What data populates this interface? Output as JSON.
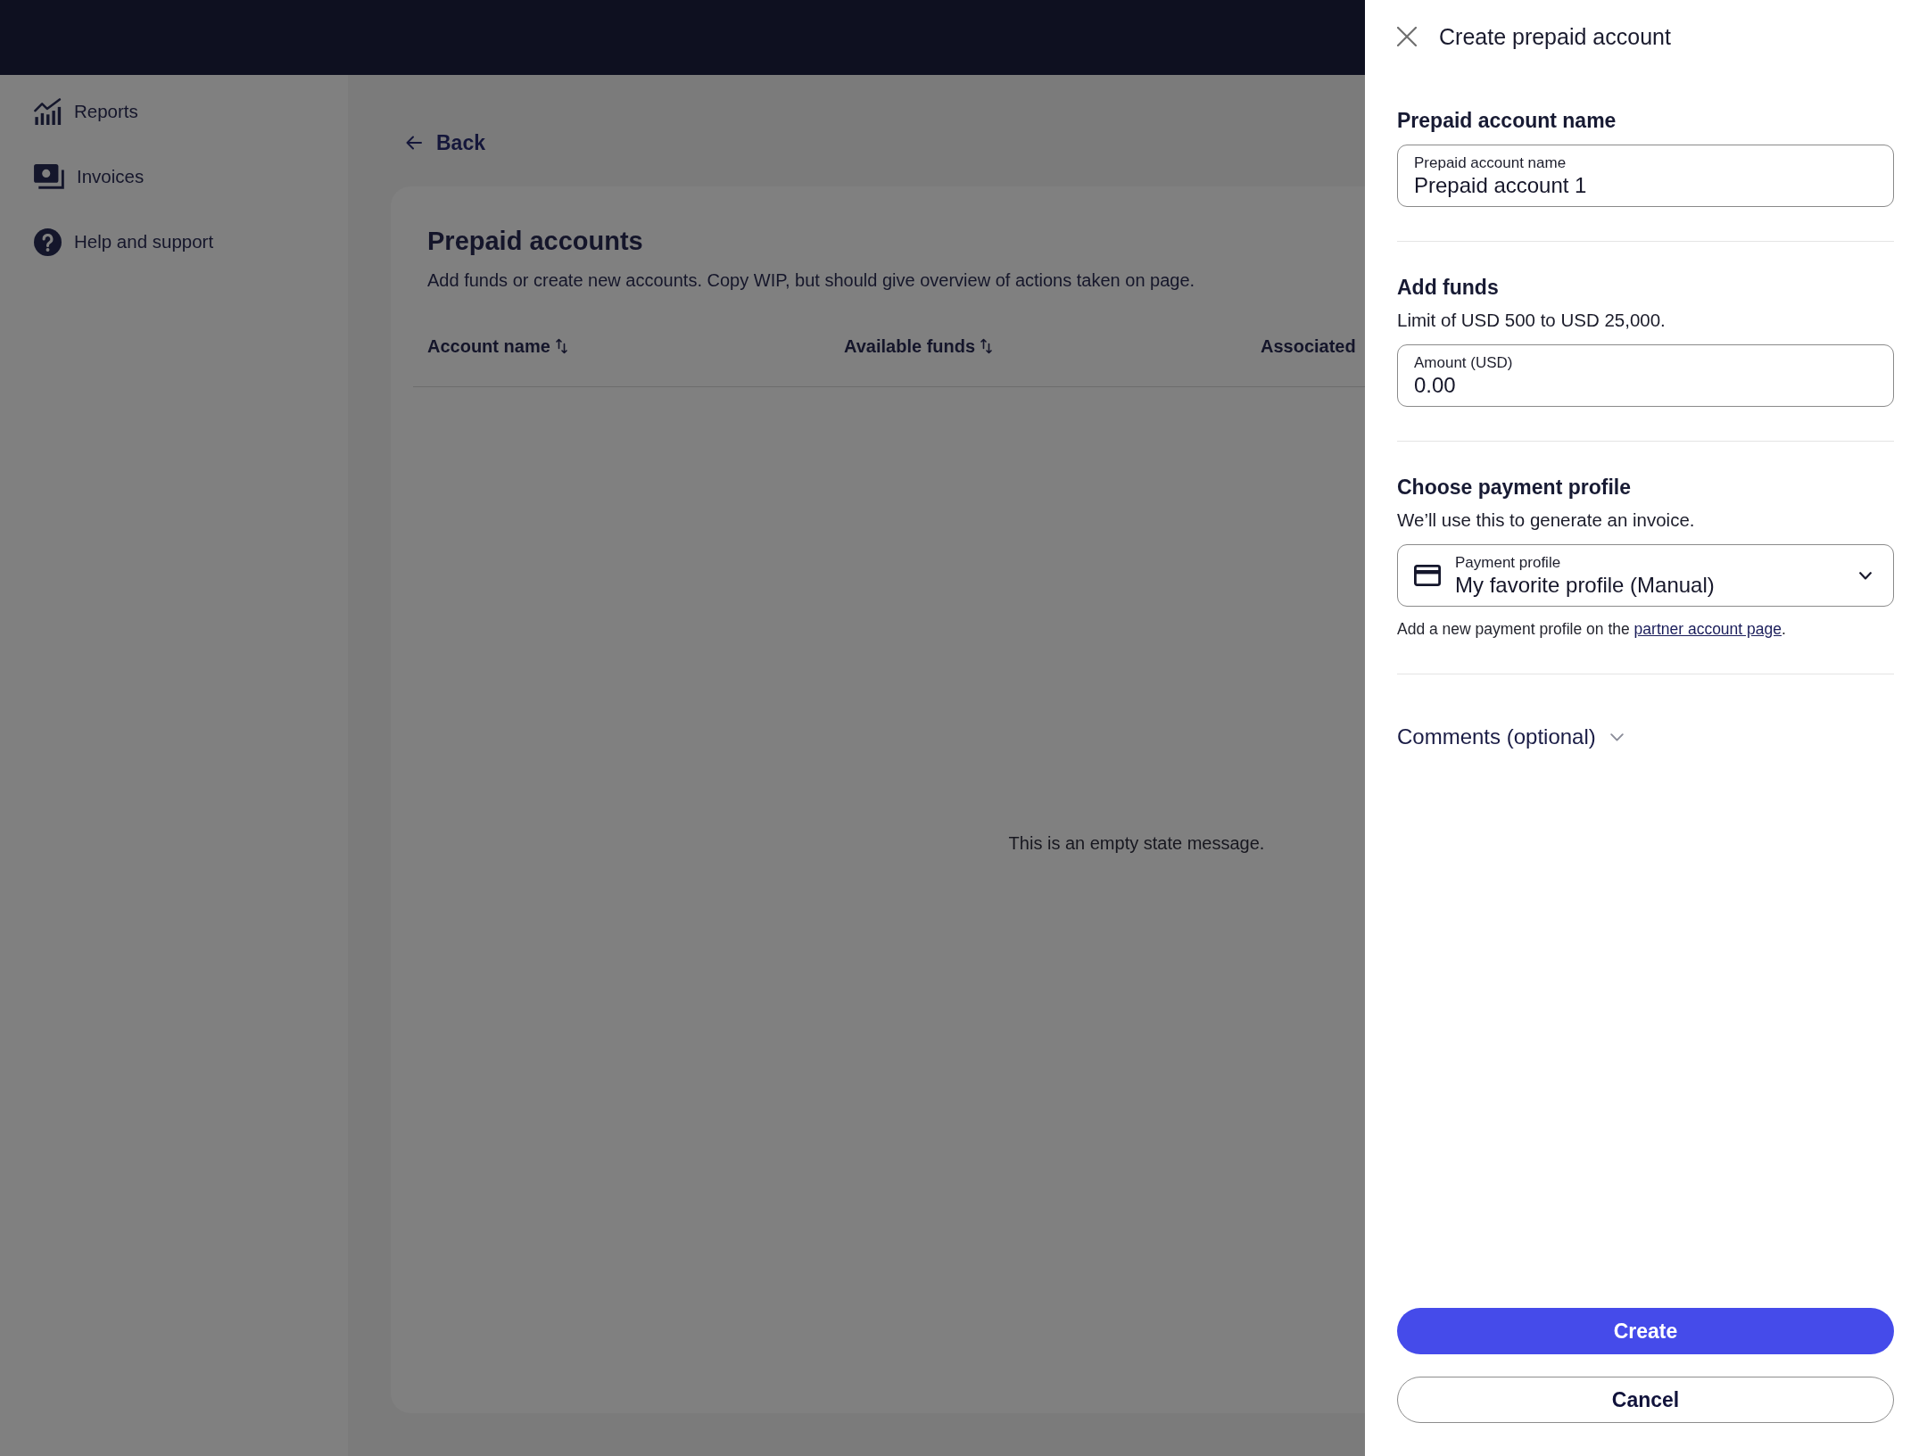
{
  "sidebar": {
    "items": [
      {
        "label": "Reports"
      },
      {
        "label": "Invoices"
      },
      {
        "label": "Help and support"
      }
    ]
  },
  "back_link": {
    "label": "Back"
  },
  "panel": {
    "title": "Prepaid accounts",
    "description": "Add funds or create new accounts. Copy WIP, but should give overview of actions taken on page.",
    "table": {
      "columns": [
        {
          "label": "Account name",
          "sortable": true
        },
        {
          "label": "Available funds",
          "sortable": true
        },
        {
          "label": "Associated",
          "sortable": false
        }
      ],
      "empty_message": "This is an empty state message."
    }
  },
  "drawer": {
    "title": "Create prepaid account",
    "sections": [
      {
        "kind": "text",
        "heading": "Prepaid account name",
        "field": {
          "label": "Prepaid account name",
          "value": "Prepaid account 1"
        }
      },
      {
        "kind": "text",
        "heading": "Add funds",
        "description": "Limit of USD 500 to USD 25,000.",
        "field": {
          "label": "Amount (USD)",
          "value": "0.00"
        }
      },
      {
        "kind": "select",
        "heading": "Choose payment profile",
        "description": "We’ll use this to generate an invoice.",
        "field": {
          "label": "Payment profile",
          "value": "My favorite profile (Manual)"
        },
        "help": {
          "text": "Add a new payment profile on the ",
          "link": "partner account page",
          "after": "."
        }
      }
    ],
    "comments": {
      "label": "Comments (optional)",
      "expanded": false
    },
    "buttons": [
      {
        "label": "Create",
        "kind": "primary"
      },
      {
        "label": "Cancel",
        "kind": "secondary"
      }
    ]
  }
}
